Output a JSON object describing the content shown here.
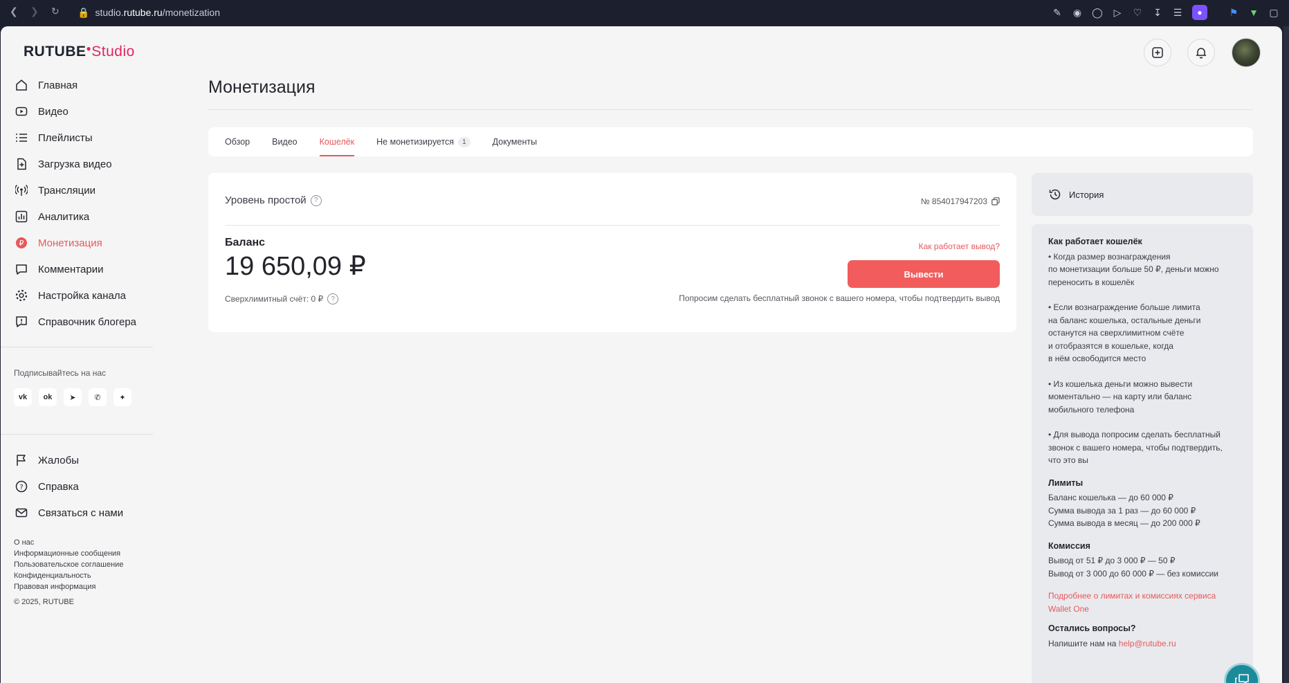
{
  "browser": {
    "url_prefix": "studio.",
    "url_domain": "rutube.ru",
    "url_path": "/monetization"
  },
  "logo": {
    "main": "RUTUBE",
    "accent": "Studio"
  },
  "sidebar": {
    "items": [
      {
        "label": "Главная",
        "icon": "home-icon"
      },
      {
        "label": "Видео",
        "icon": "video-icon"
      },
      {
        "label": "Плейлисты",
        "icon": "list-icon"
      },
      {
        "label": "Загрузка видео",
        "icon": "upload-icon"
      },
      {
        "label": "Трансляции",
        "icon": "broadcast-icon"
      },
      {
        "label": "Аналитика",
        "icon": "chart-icon"
      },
      {
        "label": "Монетизация",
        "icon": "ruble-icon",
        "active": true
      },
      {
        "label": "Комментарии",
        "icon": "comment-icon"
      },
      {
        "label": "Настройка канала",
        "icon": "gear-icon"
      },
      {
        "label": "Справочник блогера",
        "icon": "info-icon"
      }
    ],
    "subscribe_title": "Подписывайтесь на нас",
    "socials": [
      "vk",
      "ok",
      "telegram",
      "viber",
      "zen"
    ],
    "bottom_items": [
      {
        "label": "Жалобы",
        "icon": "flag-icon"
      },
      {
        "label": "Справка",
        "icon": "help-icon"
      },
      {
        "label": "Связаться с нами",
        "icon": "mail-icon"
      }
    ],
    "footer_links": [
      "О нас",
      "Информационные сообщения",
      "Пользовательское соглашение",
      "Конфиденциальность",
      "Правовая информация"
    ],
    "copyright": "© 2025, RUTUBE"
  },
  "page": {
    "title": "Монетизация",
    "tabs": [
      {
        "label": "Обзор"
      },
      {
        "label": "Видео"
      },
      {
        "label": "Кошелёк",
        "active": true
      },
      {
        "label": "Не монетизируется",
        "badge": "1"
      },
      {
        "label": "Документы"
      }
    ]
  },
  "wallet": {
    "level": "Уровень простой",
    "account": "№ 854017947203",
    "balance_label": "Баланс",
    "balance": "19 650,09 ₽",
    "overlimit": "Сверхлимитный счёт: 0 ₽",
    "how_link": "Как работает вывод?",
    "withdraw_label": "Вывести",
    "call_note": "Попросим сделать бесплатный звонок с вашего номера, чтобы подтвердить вывод"
  },
  "history": {
    "label": "История"
  },
  "info": {
    "how_title": "Как работает кошелёк",
    "points": [
      "• Когда размер вознаграждения\nпо монетизации больше 50 ₽, деньги можно\nпереносить в кошелёк",
      "• Если вознаграждение больше лимита\nна баланс кошелька, остальные деньги\nостанутся на сверхлимитном счёте\nи отобразятся в кошельке, когда\nв нём освободится место",
      "• Из кошелька деньги можно вывести\nмоментально — на карту или баланс\nмобильного телефона",
      "• Для вывода попросим сделать бесплатный\nзвонок с вашего номера, чтобы подтвердить,\nчто это вы"
    ],
    "limits_title": "Лимиты",
    "limits": "Баланс кошелька — до 60 000 ₽\nСумма вывода за 1 раз — до 60 000 ₽\nСумма вывода в месяц — до 200 000 ₽",
    "commission_title": "Комиссия",
    "commission": "Вывод от 51 ₽ до 3 000 ₽ — 50 ₽\nВывод от 3 000 до 60 000 ₽ — без комиссии",
    "more_link": "Подробнее о лимитах и комиссиях сервиса\nWallet One",
    "questions_title": "Остались вопросы?",
    "write_text": "Напишите нам на ",
    "email": "help@rutube.ru"
  }
}
